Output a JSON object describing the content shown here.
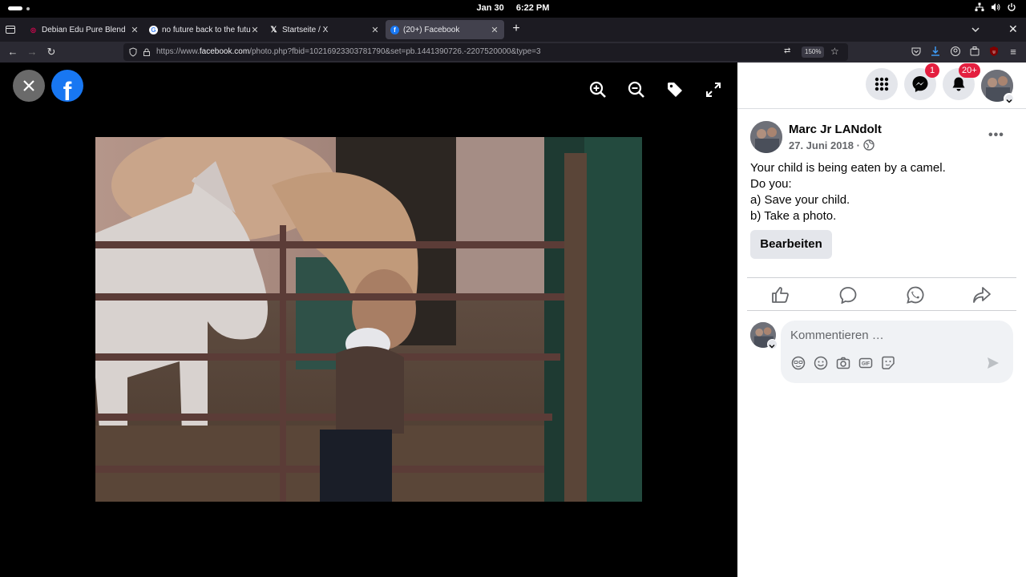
{
  "topbar": {
    "date": "Jan 30",
    "time": "6:22 PM"
  },
  "tabs": [
    {
      "title": "Debian Edu Pure Blend",
      "favicon": "debian-icon"
    },
    {
      "title": "no future back to the futu",
      "favicon": "google-icon"
    },
    {
      "title": "Startseite / X",
      "favicon": "x-icon"
    },
    {
      "title": "(20+) Facebook",
      "favicon": "facebook-icon",
      "active": true
    }
  ],
  "urlbar": {
    "url_prefix": "https://www.",
    "url_domain": "facebook.com",
    "url_rest": "/photo.php?fbid=10216923303781790&set=pb.1441390726.-2207520000&type=3",
    "zoom": "150%"
  },
  "colors": {
    "facebook_blue": "#1877f2",
    "badge_red": "#e41e3f"
  },
  "panel": {
    "messenger_badge": "1",
    "notifications_badge": "20+"
  },
  "post": {
    "author": "Marc Jr LANdolt",
    "date": "27. Juni 2018",
    "date_sep": "·",
    "lines": [
      "Your child is being eaten by a camel.",
      "Do you:",
      "a) Save your child.",
      "b) Take a photo."
    ],
    "edit_label": "Bearbeiten"
  },
  "comment": {
    "placeholder": "Kommentieren …"
  }
}
